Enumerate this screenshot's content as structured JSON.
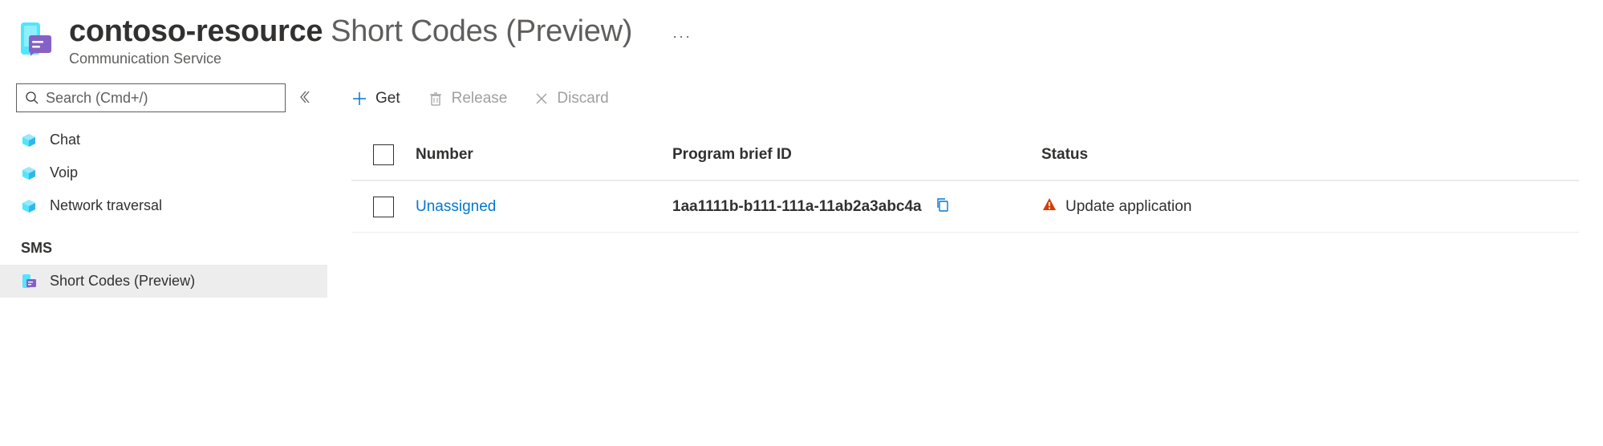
{
  "header": {
    "resource_name": "contoso-resource",
    "page_name": "Short Codes (Preview)",
    "subtitle": "Communication Service",
    "more_label": "···"
  },
  "sidebar": {
    "search_placeholder": "Search (Cmd+/)",
    "items": [
      {
        "label": "Chat"
      },
      {
        "label": "Voip"
      },
      {
        "label": "Network traversal"
      }
    ],
    "section_label": "SMS",
    "selected_item_label": "Short Codes (Preview)"
  },
  "toolbar": {
    "get_label": "Get",
    "release_label": "Release",
    "discard_label": "Discard"
  },
  "table": {
    "columns": {
      "number": "Number",
      "program": "Program brief ID",
      "status": "Status"
    },
    "rows": [
      {
        "number": "Unassigned",
        "program_id": "1aa1111b-b111-111a-11ab2a3abc4a",
        "status": "Update application"
      }
    ]
  }
}
